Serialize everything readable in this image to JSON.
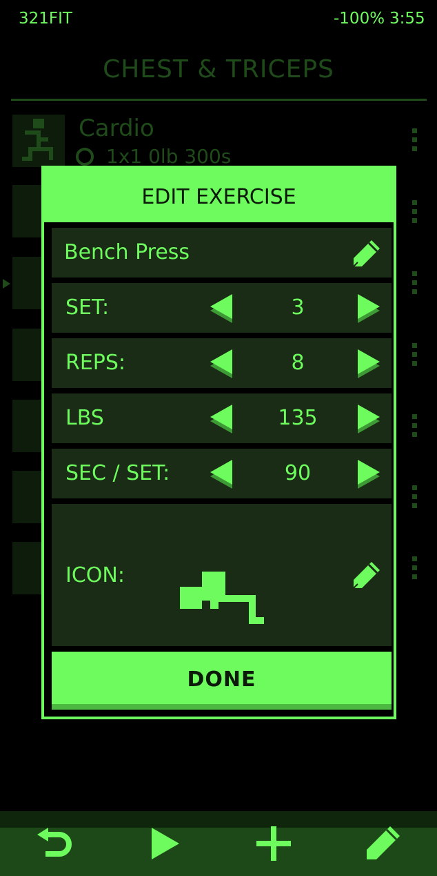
{
  "status": {
    "app_name": "321FIT",
    "battery": "-100%",
    "time": "3:55"
  },
  "page": {
    "title": "CHEST & TRICEPS"
  },
  "background_list": {
    "first_item": {
      "name": "Cardio",
      "details": "1x1  0lb  300s"
    }
  },
  "dialog": {
    "title": "EDIT EXERCISE",
    "exercise_name": "Bench Press",
    "set": {
      "label": "SET:",
      "value": "3"
    },
    "reps": {
      "label": "REPS:",
      "value": "8"
    },
    "lbs": {
      "label": "LBS",
      "value": "135"
    },
    "sec_per_set": {
      "label": "SEC / SET:",
      "value": "90"
    },
    "icon": {
      "label": "ICON:",
      "selected_icon": "bench-press-icon"
    },
    "done_label": "DONE"
  },
  "bottom_bar": {
    "icons": [
      "undo-icon",
      "play-icon",
      "plus-icon",
      "pencil-icon"
    ]
  },
  "colors": {
    "accent": "#6dfb5e",
    "dim_accent": "#1f4a19",
    "row_bg": "#1a2b16",
    "bottom_bar": "#1d4818",
    "background": "#000000"
  }
}
